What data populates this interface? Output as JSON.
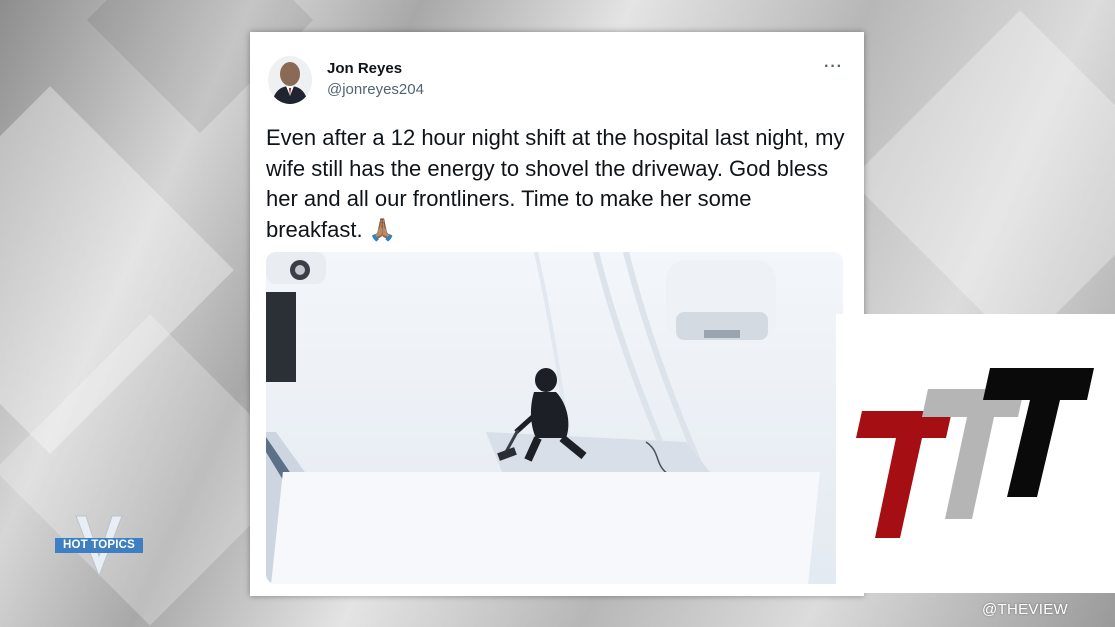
{
  "tweet": {
    "author_name": "Jon Reyes",
    "author_handle": "@jonreyes204",
    "more_menu": "···",
    "text": "Even after a 12 hour night shift at the hospital last night, my wife still has the energy to shovel the driveway. God bless her and all our frontliners. Time to make her some breakfast.",
    "emoji": "🙏🏽"
  },
  "show_logo": {
    "label": "HOT TOPICS"
  },
  "watermark": {
    "text": "@THEVIEW"
  },
  "colors": {
    "logo_red": "#a50e12",
    "logo_gray": "#b5b5b5",
    "logo_black": "#0a0a0a",
    "hot_topics_blue": "#3d7fc1"
  }
}
